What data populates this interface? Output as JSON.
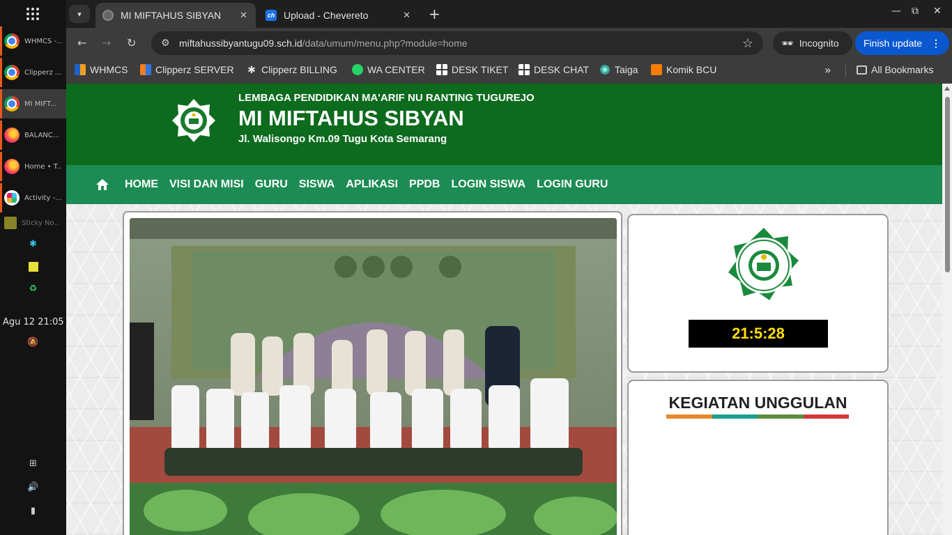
{
  "os": {
    "apps": [
      {
        "label": "WHMCS -...",
        "icon": "chrome-icon"
      },
      {
        "label": "Clipperz ...",
        "icon": "chrome-icon"
      },
      {
        "label": "MI MIFT...",
        "icon": "chrome-icon"
      },
      {
        "label": "BALANC...",
        "icon": "firefox-icon"
      },
      {
        "label": "Home • T...",
        "icon": "firefox-icon"
      },
      {
        "label": "Activity -...",
        "icon": "slack-icon"
      },
      {
        "label": "Sticky No...",
        "icon": "sticky-notes-icon"
      }
    ],
    "clock": "Agu 12  21:05"
  },
  "tabs": [
    {
      "title": "MI MIFTAHUS SIBYAN",
      "active": true
    },
    {
      "title": "Upload - Chevereto",
      "active": false
    }
  ],
  "toolbar": {
    "url_host": "miftahussibyantugu09.sch.id",
    "url_path": "/data/umum/menu.php?module=home",
    "incognito_label": "Incognito",
    "finish_update_label": "Finish update"
  },
  "bookmarks": {
    "items": [
      "WHMCS",
      "Clipperz SERVER",
      "Clipperz BILLING",
      "WA CENTER",
      "DESK TIKET",
      "DESK CHAT",
      "Taiga",
      "Komik BCU"
    ],
    "all_label": "All Bookmarks"
  },
  "site": {
    "line1": "LEMBAGA PENDIDIKAN MA'ARIF NU RANTING TUGUREJO",
    "title": "MI MIFTAHUS SIBYAN",
    "address": "Jl. Walisongo Km.09 Tugu Kota Semarang",
    "nav": [
      "HOME",
      "VISI DAN MISI",
      "GURU",
      "SISWA",
      "APLIKASI",
      "PPDB",
      "LOGIN SISWA",
      "LOGIN GURU"
    ],
    "clock": "21:5:28",
    "kegiatan_title": "KEGIATAN UNGGULAN",
    "kegiatan_bar_colors": [
      "#e5892c",
      "#1a9e8e",
      "#5a8e3c",
      "#d03a3a"
    ],
    "brand_green": "#0d6b1e",
    "nav_green": "#1c8c54"
  }
}
